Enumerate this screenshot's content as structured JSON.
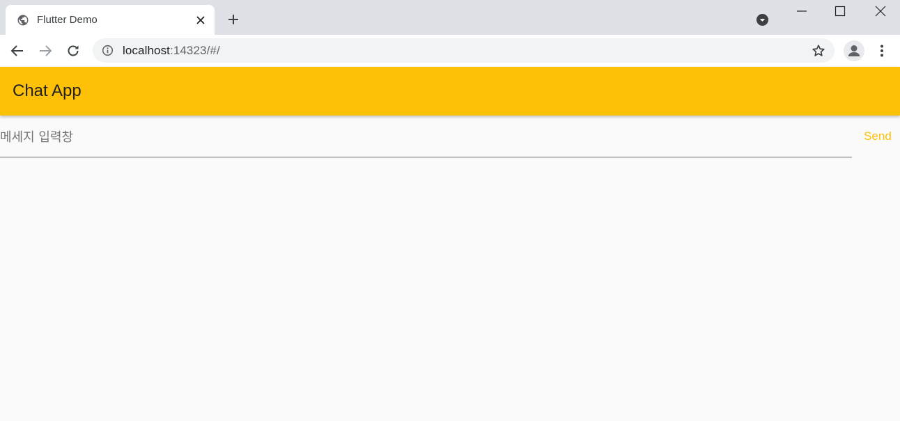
{
  "browser": {
    "tab": {
      "title": "Flutter Demo"
    },
    "address_bar": {
      "host": "localhost",
      "rest": ":14323/#/"
    }
  },
  "app": {
    "title": "Chat App",
    "composer": {
      "placeholder": "메세지 입력창",
      "value": "",
      "send_label": "Send"
    }
  },
  "colors": {
    "accent": "#ffc107",
    "tabstrip": "#dee1e6",
    "omnibox": "#f1f3f4",
    "background": "#fafafa"
  },
  "icons": {
    "favicon": "globe-icon",
    "tab_close": "close-icon",
    "new_tab": "plus-icon",
    "tab_search": "chevron-down-circle-icon",
    "back": "arrow-left-icon",
    "forward": "arrow-right-icon",
    "reload": "reload-icon",
    "site_info": "info-icon",
    "bookmark": "star-icon",
    "profile": "person-icon",
    "menu": "kebab-menu-icon"
  }
}
